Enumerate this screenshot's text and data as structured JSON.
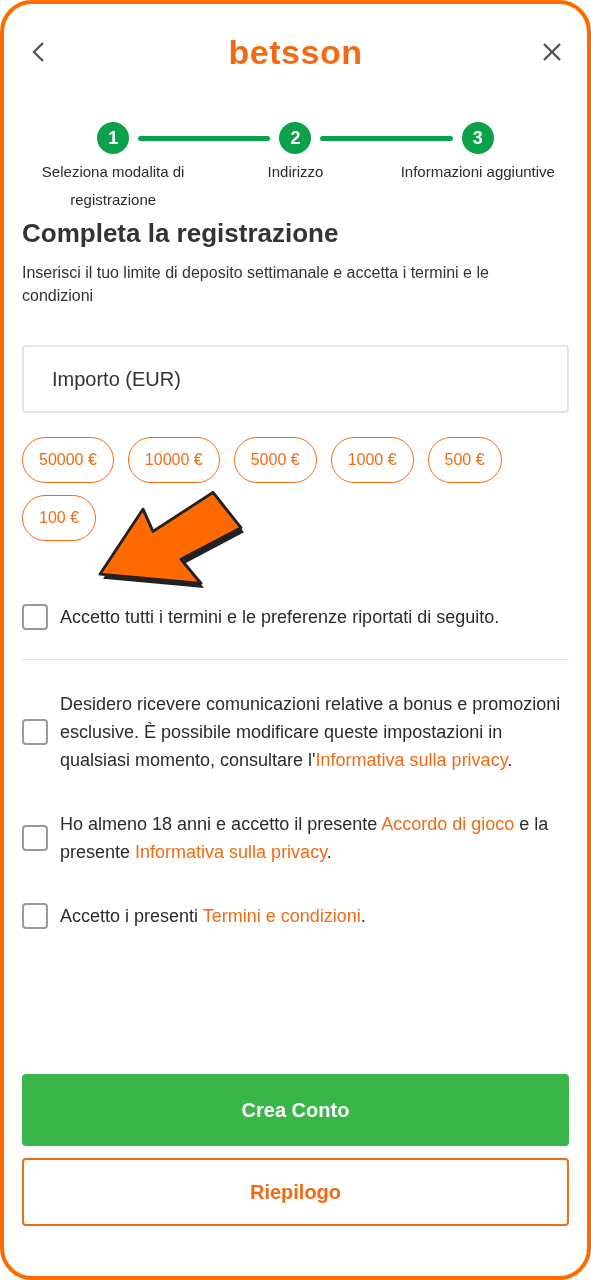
{
  "header": {
    "logo": "betsson"
  },
  "steps": [
    {
      "number": "1",
      "label": "Seleziona modalita di registrazione"
    },
    {
      "number": "2",
      "label": "Indirizzo"
    },
    {
      "number": "3",
      "label": "Informazioni aggiuntive"
    }
  ],
  "title": "Completa la registrazione",
  "subtitle": "Inserisci il tuo limite di deposito settimanale e accetta i termini e le condizioni",
  "amount_field": {
    "placeholder": "Importo (EUR)"
  },
  "amount_chips": [
    {
      "label": "50000 €",
      "selected": false
    },
    {
      "label": "10000 €",
      "selected": false
    },
    {
      "label": "5000 €",
      "selected": false
    },
    {
      "label": "1000 €",
      "selected": false
    },
    {
      "label": "500 €",
      "selected": false
    },
    {
      "label": "100 €",
      "selected": false
    }
  ],
  "accept_all": {
    "checked": false,
    "segments": [
      {
        "kind": "plain",
        "text": "Accetto tutti i termini e le preferenze riportati di seguito."
      }
    ]
  },
  "consents": [
    {
      "checked": false,
      "segments": [
        {
          "kind": "plain",
          "text": "Desidero ricevere comunicazioni relative a bonus e promozioni esclusive. È possibile modificare queste impostazioni in qualsiasi momento, consultare l'"
        },
        {
          "kind": "link",
          "text": "Informativa sulla privacy"
        },
        {
          "kind": "plain",
          "text": "."
        }
      ]
    },
    {
      "checked": false,
      "segments": [
        {
          "kind": "plain",
          "text": "Ho almeno 18 anni e accetto il presente "
        },
        {
          "kind": "link",
          "text": "Accordo di gioco"
        },
        {
          "kind": "plain",
          "text": " e la presente "
        },
        {
          "kind": "link",
          "text": "Informativa sulla privacy"
        },
        {
          "kind": "plain",
          "text": "."
        }
      ]
    },
    {
      "checked": false,
      "segments": [
        {
          "kind": "plain",
          "text": "Accetto i presenti "
        },
        {
          "kind": "link",
          "text": "Termini e condizioni"
        },
        {
          "kind": "plain",
          "text": "."
        }
      ]
    }
  ],
  "buttons": [
    {
      "kind": "primary",
      "label": "Crea Conto"
    },
    {
      "kind": "secondary",
      "label": "Riepilogo"
    }
  ]
}
